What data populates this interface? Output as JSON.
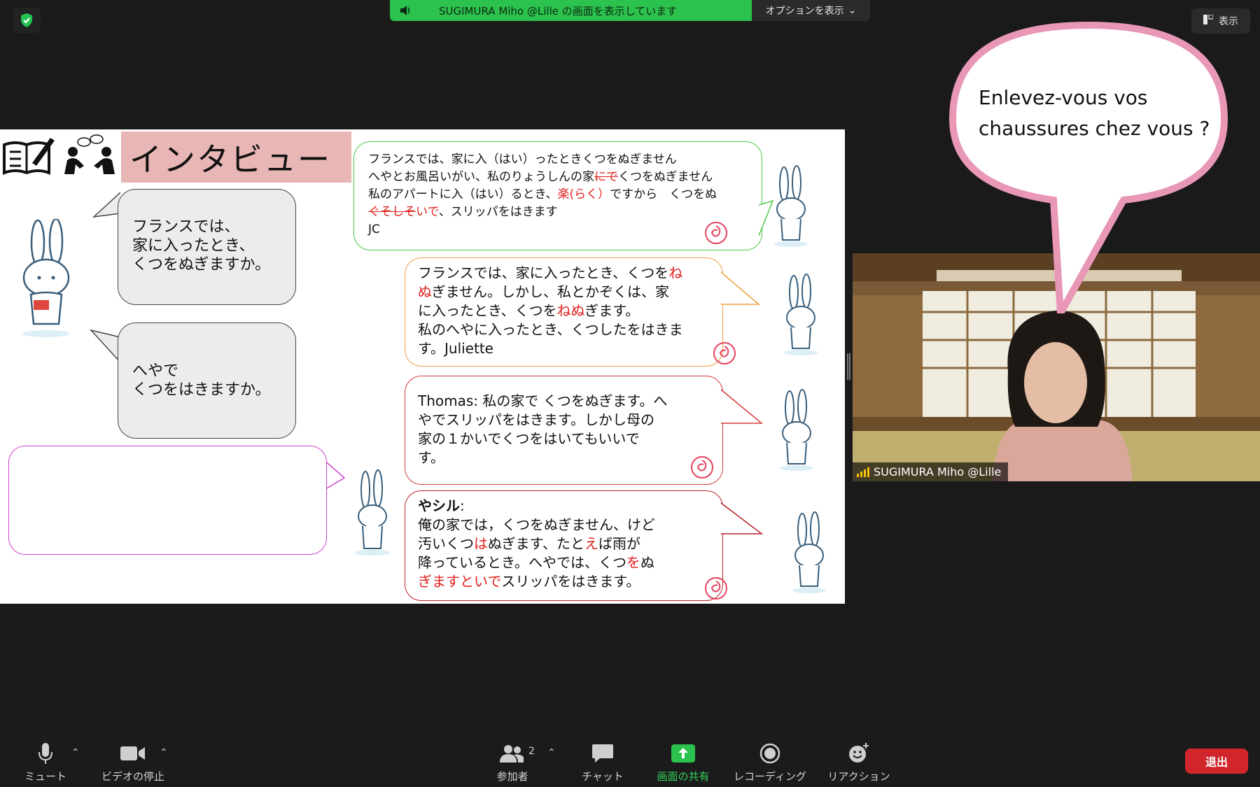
{
  "top": {
    "share_banner": "SUGIMURA Miho @Lille の画面を表示しています",
    "options_label": "オプションを表示",
    "view_label": "表示"
  },
  "slide": {
    "title": "インタビュー",
    "q1": [
      "フランスでは、",
      "家に入ったとき、",
      "くつをぬぎますか。"
    ],
    "q2": [
      "へやで",
      "くつをはきますか。"
    ],
    "jc": {
      "l1": "フランスでは、家に入（はい）ったときくつをぬぎません",
      "l2a": "へやとお風呂いがい、私のりょうしんの家",
      "l2b": "にで",
      "l2c": "くつをぬぎません",
      "l3a": "私のアパートに入（はい）るとき、",
      "l3b": "楽(らく）",
      "l3c": "ですから　くつをぬ",
      "l4a": "ぐそしそ",
      "l4b": "いで",
      "l4c": "、スリッパをはきます",
      "l5": "JC"
    },
    "juliette": {
      "p1": "フランスでは、家に入ったとき、くつを",
      "r1": "ね",
      "p2": "ぬ",
      "p3": "ぎません。しかし、私とかぞくは、家",
      "p4": "に入ったとき、くつを",
      "r2": "ねぬ",
      "p5": "ぎます。",
      "p6": "私のへやに入ったとき、くつしたをはきま",
      "p7": "す。Juliette"
    },
    "thomas": [
      "Thomas: 私の家で くつをぬぎます。へ",
      "やでスリッパをはきます。しかし母の",
      "家の１かいでくつをはいてもいいで",
      "す。"
    ],
    "yashiru": {
      "name": "やシル",
      "colon": ":",
      "l1": "俺の家では，くつをぬぎません、けど",
      "l2a": "汚いくつ",
      "l2b": "は",
      "l2c": "ぬぎます、たと",
      "l2d": "え",
      "l2e": "ば雨が",
      "l3a": "降っているとき。へやでは、くつ",
      "l3b": "を",
      "l3c": "ぬ",
      "l4a": "ぎますといで",
      "l4b": "スリッパをはきます。"
    }
  },
  "video": {
    "name": "SUGIMURA Miho @Lille",
    "bubble_text": [
      "Enlevez-vous vos",
      "chaussures chez vous ?"
    ]
  },
  "toolbar": {
    "mute": "ミュート",
    "video_stop": "ビデオの停止",
    "participants": "参加者",
    "participants_count": "2",
    "chat": "チャット",
    "share": "画面の共有",
    "recording": "レコーディング",
    "reaction": "リアクション",
    "leave": "退出"
  },
  "colors": {
    "share_green": "#2bc24d",
    "leave_red": "#d0262b",
    "title_pink": "#e8b6b4",
    "bubble_pink": "#e997b7",
    "annotation_red": "#e0201c"
  }
}
